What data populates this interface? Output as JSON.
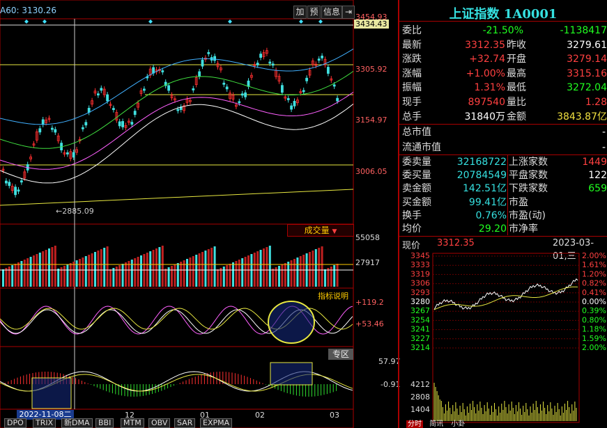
{
  "header": {
    "ma_label": "A60: 3130.26",
    "buttons": {
      "add": "加",
      "predict": "预",
      "info": "信息",
      "exit": "⇥"
    }
  },
  "price_axis": {
    "top": "3454.93",
    "highlight": "3434.43",
    "l1": "3305.92",
    "l2": "3154.97",
    "l3": "3006.05"
  },
  "low_marker": "2885.09",
  "volume": {
    "title": "成交量",
    "max": "55058",
    "mid": "27917"
  },
  "indicator": {
    "title": "指标说明",
    "v1": "+119.2",
    "v2": "+53.46"
  },
  "macd": {
    "title": "专区",
    "v1": "57.97",
    "v2": "-0.91"
  },
  "date_axis": {
    "start": "2022-11-08二",
    "m12": "12",
    "m01": "01",
    "m02": "02",
    "m03": "03"
  },
  "bottom_tabs": [
    "DPO",
    "TRIX",
    "新DMA",
    "BBI",
    "MTM",
    "OBV",
    "SAR",
    "EXPMA"
  ],
  "quote": {
    "title": "上证指数 1A0001",
    "rows": [
      {
        "l": "委比",
        "v": "-21.50%",
        "r": "-1138417"
      },
      {
        "l": "最新",
        "v": "3312.35",
        "l2": "昨收",
        "v2": "3279.61"
      },
      {
        "l": "涨跌",
        "v": "+32.74",
        "l2": "开盘",
        "v2": "3279.14"
      },
      {
        "l": "涨幅",
        "v": "+1.00%",
        "l2": "最高",
        "v2": "3315.16"
      },
      {
        "l": "振幅",
        "v": "1.31%",
        "l2": "最低",
        "v2": "3272.04"
      },
      {
        "l": "现手",
        "v": "897540",
        "l2": "量比",
        "v2": "1.28"
      },
      {
        "l": "总手",
        "v": "31840万",
        "l2": "金额",
        "v2": "3843.87亿"
      }
    ],
    "mcap": "总市值",
    "float_mcap": "流通市值",
    "rows2": [
      {
        "l": "委卖量",
        "v": "32168722",
        "l2": "上涨家数",
        "v2": "1449"
      },
      {
        "l": "委买量",
        "v": "20784549",
        "l2": "平盘家数",
        "v2": "122"
      },
      {
        "l": "卖金额",
        "v": "142.51亿",
        "l2": "下跌家数",
        "v2": "659"
      },
      {
        "l": "买金额",
        "v": "99.41亿",
        "l2": "市盈",
        "v2": ""
      },
      {
        "l": "换手",
        "v": "0.76%",
        "l2": "市盈(动)",
        "v2": ""
      },
      {
        "l": "均价",
        "v": "29.20",
        "l2": "市净率",
        "v2": ""
      }
    ]
  },
  "intraday": {
    "label": "现价",
    "price": "3312.35",
    "date": "2023-03-01,三",
    "left_axis": [
      "3345",
      "3333",
      "3319",
      "3306",
      "3293",
      "3280",
      "3267",
      "3254",
      "3241",
      "3227",
      "3214"
    ],
    "right_axis": [
      "2.00%",
      "1.61%",
      "1.20%",
      "0.82%",
      "0.41%",
      "0.00%",
      "0.39%",
      "0.80%",
      "1.18%",
      "1.59%",
      "2.00%"
    ],
    "vol_axis": [
      "4212",
      "2808",
      "1404"
    ],
    "tabs": [
      "分时",
      "简讯",
      "小卦"
    ]
  }
}
